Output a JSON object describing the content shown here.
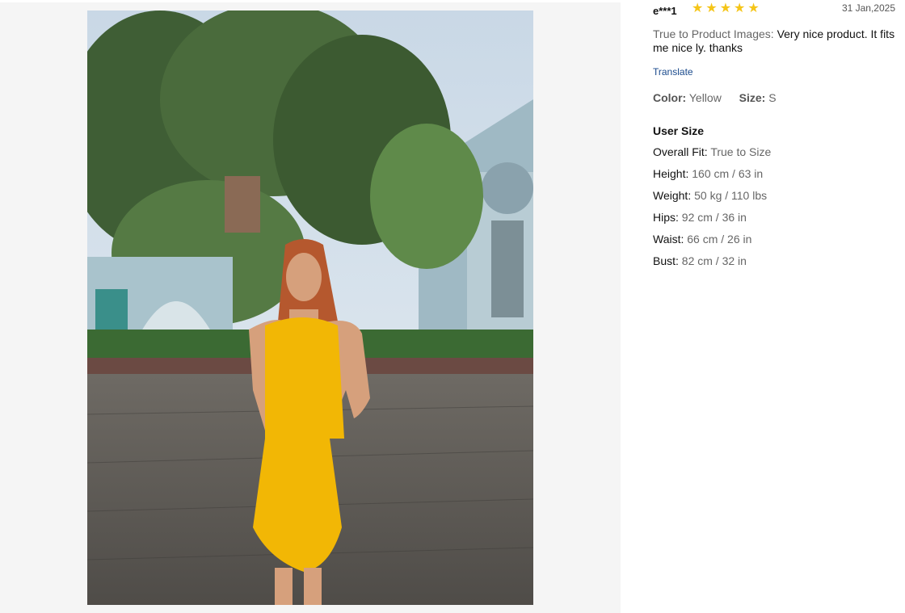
{
  "review": {
    "user": "e***1",
    "rating": 5,
    "date": "31 Jan,2025",
    "body_label": "True to Product Images:",
    "body_text": "Very nice product. It fits me nice ly. thanks",
    "translate": "Translate",
    "color_label": "Color:",
    "color_value": "Yellow",
    "size_label": "Size:",
    "size_value": "S"
  },
  "user_size": {
    "title": "User Size",
    "rows": [
      {
        "label": "Overall Fit:",
        "value": "True to Size"
      },
      {
        "label": "Height:",
        "value": "160 cm / 63 in"
      },
      {
        "label": "Weight:",
        "value": "50 kg / 110 lbs"
      },
      {
        "label": "Hips:",
        "value": "92 cm / 36 in"
      },
      {
        "label": "Waist:",
        "value": "66 cm / 26 in"
      },
      {
        "label": "Bust:",
        "value": "82 cm / 32 in"
      }
    ]
  },
  "colors": {
    "star": "#f5c518",
    "dress": "#f2b705",
    "link": "#1a4a8c"
  },
  "icons": {
    "star": "star-icon"
  }
}
